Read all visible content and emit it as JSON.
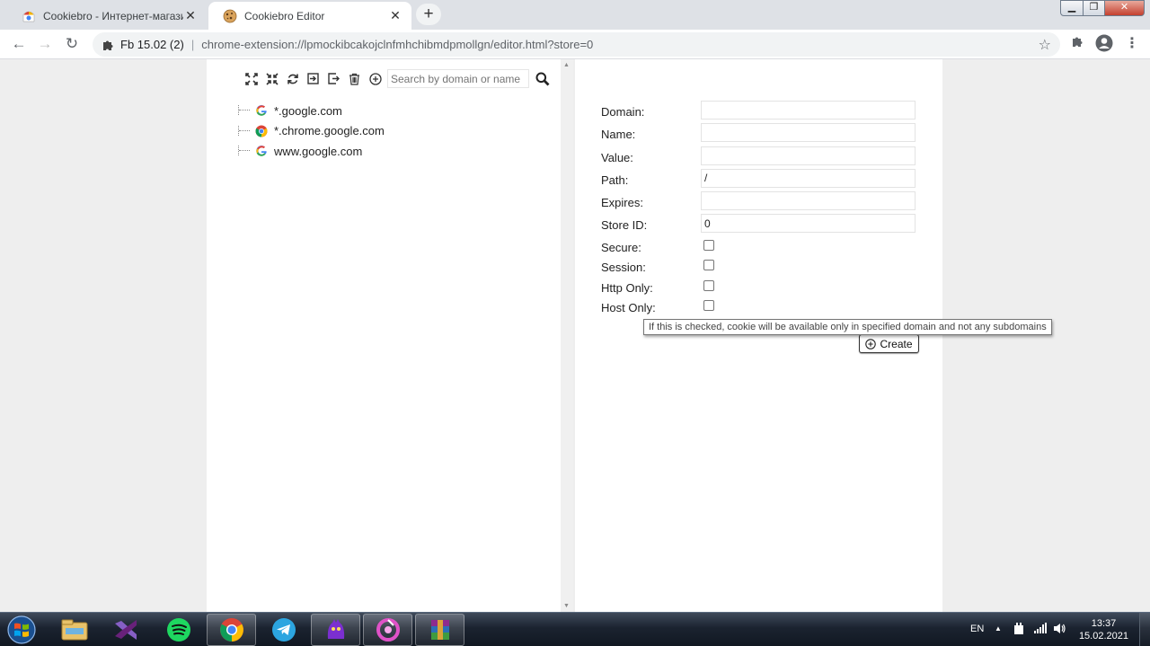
{
  "tabs": [
    {
      "title": "Cookiebro - Интернет-магазин Chrome",
      "active": false
    },
    {
      "title": "Cookiebro Editor",
      "active": true
    }
  ],
  "address_bar": {
    "extension_name": "Fb 15.02 (2)",
    "url": "chrome-extension://lpmockibcakojclnfmhchibmdpmollgn/editor.html?store=0"
  },
  "toolbar_icons": [
    "expand-all-icon",
    "collapse-all-icon",
    "refresh-icon",
    "import-icon",
    "export-icon",
    "delete-all-icon",
    "add-cookie-icon"
  ],
  "search": {
    "placeholder": "Search by domain or name",
    "value": ""
  },
  "tree": [
    {
      "label": "*.google.com",
      "icon": "google-favicon"
    },
    {
      "label": "*.chrome.google.com",
      "icon": "chrome-favicon"
    },
    {
      "label": "www.google.com",
      "icon": "google-favicon"
    }
  ],
  "form": {
    "fields": [
      {
        "label": "Domain:",
        "value": ""
      },
      {
        "label": "Name:",
        "value": ""
      },
      {
        "label": "Value:",
        "value": ""
      },
      {
        "label": "Path:",
        "value": "/"
      },
      {
        "label": "Expires:",
        "value": ""
      },
      {
        "label": "Store ID:",
        "value": "0"
      }
    ],
    "checkboxes": [
      {
        "label": "Secure:",
        "checked": false
      },
      {
        "label": "Session:",
        "checked": false
      },
      {
        "label": "Http Only:",
        "checked": false
      },
      {
        "label": "Host Only:",
        "checked": false
      }
    ],
    "create_label": "Create"
  },
  "tooltip": "If this is checked, cookie will be available only in specified domain and not any subdomains",
  "taskbar": {
    "apps": [
      "explorer",
      "visual-studio",
      "spotify",
      "chrome",
      "telegram",
      "purple-app",
      "pink-app",
      "winrar"
    ],
    "language": "EN",
    "time": "13:37",
    "date": "15.02.2021"
  },
  "colors": {
    "chrome_tab_bar": "#dee1e6",
    "panel_bg": "#ffffff",
    "page_bg": "#eeeeee",
    "taskbar": "#1b2330"
  }
}
